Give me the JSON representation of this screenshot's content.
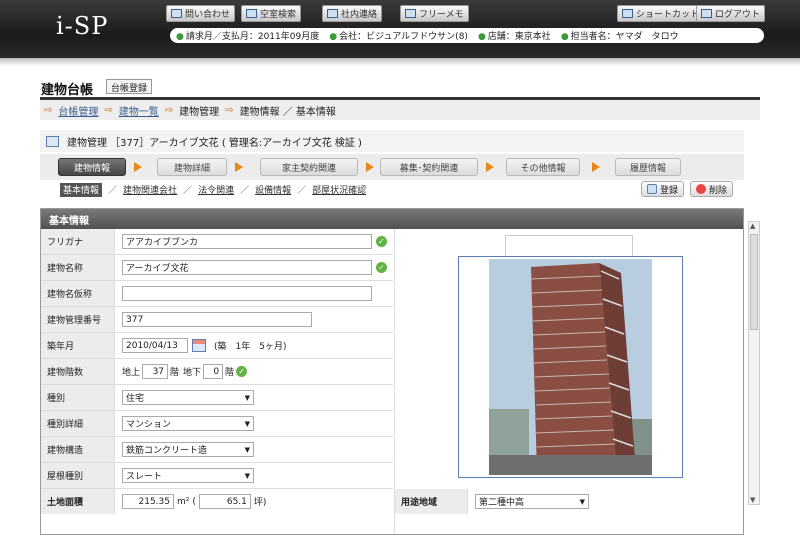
{
  "header": {
    "logo": "i-SP",
    "buttons": [
      "問い合わせ",
      "空室検索",
      "社内連絡",
      "フリーメモ",
      "ショートカット",
      "ログアウト"
    ],
    "info": [
      {
        "label": "請求月／支払月：2011年09月度"
      },
      {
        "label": "会社：ビジュアルフドウサン(8)"
      },
      {
        "label": "店舗：東京本社"
      },
      {
        "label": "担当者名：ヤマダ　タロウ"
      }
    ]
  },
  "page": {
    "title": "建物台帳",
    "ledger_button": "台帳登録",
    "breadcrumb": [
      "台帳管理",
      "建物一覧",
      "建物管理",
      "建物情報 ／ 基本情報"
    ]
  },
  "building": {
    "heading": "建物管理 ［377］アーカイブ文花 ( 管理名:アーカイブ文花 検証 )"
  },
  "steps": [
    "建物情報",
    "建物詳細",
    "家主契約関連",
    "募集･契約関連",
    "その他情報",
    "履歴情報"
  ],
  "subtabs": [
    "基本情報",
    "建物関連会社",
    "法令関連",
    "設備情報",
    "部屋状況確認"
  ],
  "actions": {
    "register": "登録",
    "delete": "削除"
  },
  "section": {
    "title": "基本情報",
    "fields": {
      "furigana": {
        "label": "フリガナ",
        "value": "アアカイブブンカ"
      },
      "name": {
        "label": "建物名称",
        "value": "アーカイブ文花"
      },
      "provisional": {
        "label": "建物名仮称",
        "value": ""
      },
      "mgmt_no": {
        "label": "建物管理番号",
        "value": "377"
      },
      "built": {
        "label": "築年月",
        "value": "2010/04/13",
        "age": "(築　1年　5ヶ月)"
      },
      "floors": {
        "label": "建物階数",
        "above_label": "地上",
        "above": "37",
        "unit": "階",
        "below_label": "地下",
        "below": "0"
      },
      "kind": {
        "label": "種別",
        "value": "住宅"
      },
      "kind_detail": {
        "label": "種別詳細",
        "value": "マンション"
      },
      "structure": {
        "label": "建物構造",
        "value": "鉄筋コンクリート造"
      },
      "roof": {
        "label": "屋根種別",
        "value": "スレート"
      },
      "land": {
        "label": "土地面積",
        "value": "215.35",
        "unit": "m²",
        "tsubo": "65.1",
        "tsubo_unit": "坪)"
      },
      "zoning": {
        "label": "用途地域",
        "value": "第二種中高"
      }
    }
  },
  "colors": {
    "accent": "#e7871b",
    "link": "#3a5f8f",
    "ok": "#5fb344"
  }
}
